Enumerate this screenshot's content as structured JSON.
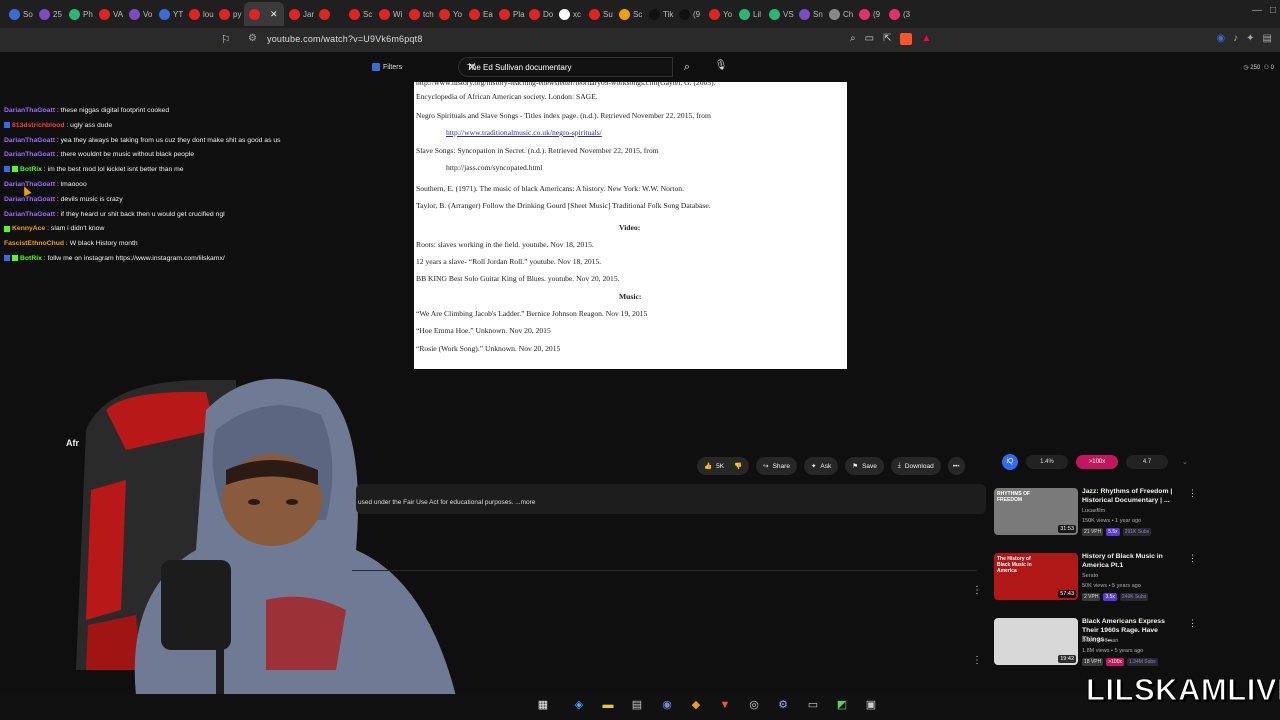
{
  "browser": {
    "tabs": [
      {
        "label": "So",
        "color": "#3b6bd6"
      },
      {
        "label": "25",
        "color": "#7a4cc2"
      },
      {
        "label": "Ph",
        "color": "#2bb673"
      },
      {
        "label": "VA",
        "color": "#e02424"
      },
      {
        "label": "Vo",
        "color": "#7a4cc2"
      },
      {
        "label": "YT",
        "color": "#3b6bd6"
      },
      {
        "label": "lou",
        "color": "#e02424"
      },
      {
        "label": "py",
        "color": "#e02424"
      },
      {
        "label": "",
        "color": "#e02424",
        "active": true
      },
      {
        "label": "Jar",
        "color": "#e02424"
      },
      {
        "label": "",
        "color": "#e02424"
      },
      {
        "label": "Sc",
        "color": "#e02424"
      },
      {
        "label": "Wi",
        "color": "#e02424"
      },
      {
        "label": "tch",
        "color": "#e02424"
      },
      {
        "label": "Yo",
        "color": "#e02424"
      },
      {
        "label": "Ea",
        "color": "#e02424"
      },
      {
        "label": "Pla",
        "color": "#e02424"
      },
      {
        "label": "Do",
        "color": "#e02424"
      },
      {
        "label": "xc",
        "color": "#ffffff"
      },
      {
        "label": "Su",
        "color": "#e02424"
      },
      {
        "label": "Sc",
        "color": "#f0a000"
      },
      {
        "label": "Tik",
        "color": "#111111"
      },
      {
        "label": "(9",
        "color": "#111111"
      },
      {
        "label": "Yo",
        "color": "#e02424"
      },
      {
        "label": "Lil",
        "color": "#2bb673"
      },
      {
        "label": "VS",
        "color": "#2bb673"
      },
      {
        "label": "Sn",
        "color": "#7a4cc2"
      },
      {
        "label": "Ch",
        "color": "#888888"
      },
      {
        "label": "(9",
        "color": "#e1306c"
      },
      {
        "label": "(3",
        "color": "#e1306c"
      }
    ],
    "url": "youtube.com/watch?v=U9Vk6m6pqt8"
  },
  "yt": {
    "filters_label": "Filters",
    "search_value": "The Ed Sullivan  documentary",
    "counter": "250",
    "counter2": "0"
  },
  "doc": {
    "lines": [
      {
        "text": "http://www.history.org/history-teaching-enewsletter/february09-worksongs.cfm(Gaytel, G. (2005).",
        "cls": ""
      },
      {
        "text": "Encyclopedia of African American society. London: SAGE.",
        "cls": ""
      },
      {
        "text": "Negro Spirituals and Slave Songs - Titles index page. (n.d.). Retrieved November 22, 2015, from",
        "cls": ""
      },
      {
        "text": "http://www.traditionalmusic.co.uk/negro-spirituals/",
        "cls": "lnk"
      },
      {
        "text": "Slave Songs: Syncopation in Secret. (n.d.). Retrieved November 22, 2015, from",
        "cls": ""
      },
      {
        "text": "http://jass.com/syncopated.html",
        "cls": ""
      },
      {
        "text": "Southern, E. (1971). The music of black Americans: A history. New York: W.W. Norton.",
        "cls": ""
      },
      {
        "text": "Taylor, B. (Arranger) Follow the Drinking Gourd [Sheet Music] Traditional Folk Song Database.",
        "cls": ""
      },
      {
        "text": "Video:",
        "cls": "hd"
      },
      {
        "text": "Roots: slaves working in the field. youtube. Nov 18, 2015.",
        "cls": ""
      },
      {
        "text": "12 years a slave- “Roll Jordan Roll.” youtube. Nov 18, 2015.",
        "cls": ""
      },
      {
        "text": "BB KING Best Solo Guitar King of Blues. youtube. Nov 20, 2015.",
        "cls": ""
      },
      {
        "text": "Music:",
        "cls": "hd"
      },
      {
        "text": "“We Are Climbing Jacob's Ladder.” Bernice Johnson Reagon. Nov 19, 2015",
        "cls": ""
      },
      {
        "text": "“Hoe Emma Hoe.” Unknown. Nov 20, 2015",
        "cls": ""
      },
      {
        "text": "“Rosie (Work Song).” Unknown. Nov 20, 2015",
        "cls": ""
      }
    ]
  },
  "chat": [
    {
      "user": "DarianThaGoatt",
      "color": "#9b6bff",
      "msg": "these niggas digital footprint cooked",
      "badges": []
    },
    {
      "user": "813dstrichblood",
      "color": "#ff3b3b",
      "msg": "ugly ass dude",
      "badges": [
        "#2f6bf5"
      ]
    },
    {
      "user": "DarianThaGoatt",
      "color": "#9b6bff",
      "msg": "yea they always be taking from us cuz they dont make shit as good as us",
      "badges": []
    },
    {
      "user": "DarianThaGoatt",
      "color": "#9b6bff",
      "msg": "there wouldnt be music without black people",
      "badges": []
    },
    {
      "user": "BotRix",
      "color": "#53fc18",
      "msg": "im the best mod lol kicklet isnt better than me",
      "badges": [
        "#2f6bf5",
        "#53fc18"
      ]
    },
    {
      "user": "DarianThaGoatt",
      "color": "#9b6bff",
      "msg": "lmaoooo",
      "badges": []
    },
    {
      "user": "DarianThaGoatt",
      "color": "#9b6bff",
      "msg": "devils music is crazy",
      "badges": []
    },
    {
      "user": "DarianThaGoatt",
      "color": "#9b6bff",
      "msg": "if they heard ur shit back then u would get crucified ngl",
      "badges": []
    },
    {
      "user": "KennyAce",
      "color": "#f0a000",
      "msg": "slam i didn't know",
      "badges": [
        "#53fc18"
      ]
    },
    {
      "user": "FascistEthnoChud",
      "color": "#f0a000",
      "msg": "W black History month",
      "badges": []
    },
    {
      "user": "BotRix",
      "color": "#53fc18",
      "msg": "follw me on instagram https://www.instagram.com/lilskamx/",
      "badges": [
        "#2f6bf5",
        "#53fc18"
      ]
    }
  ],
  "video": {
    "title": "Afr",
    "like_count": "5K",
    "share_label": "Share",
    "ask_label": "Ask",
    "save_label": "Save",
    "download_label": "Download",
    "description": "used under the Fair Use Act for educational purposes.  ...more"
  },
  "extension": {
    "stat1": "1.4%",
    "stat2": ">100x",
    "stat3": "4.7"
  },
  "recommendations": [
    {
      "title": "Jazz: Rhythms of Freedom | Historical Documentary | ...",
      "channel": "Lucasfilm",
      "meta": "150K views • 1 year ago",
      "duration": "31:53",
      "thumb_text": "RHYTHMS OF FREEDOM",
      "badges": [
        "21 VPH",
        "5.5x",
        "291K Subs"
      ],
      "thumb_bg": "#7a7a7a"
    },
    {
      "title": "History of Black Music in America Pt.1",
      "channel": "Serato",
      "meta": "50K views • 5 years ago",
      "duration": "57:43",
      "thumb_text": "The History of Black Music in America",
      "badges": [
        "2 VPH",
        "3.5x",
        "249K Subs"
      ],
      "thumb_bg": "#b01818"
    },
    {
      "title": "Black Americans Express Their 1960s Rage. Have Things ...",
      "channel": "David Hoffman",
      "meta": "1.8M views • 5 years ago",
      "duration": "19:42",
      "thumb_text": "",
      "badges": [
        "18 VPH",
        ">100x",
        "1.34M Subs"
      ],
      "thumb_bg": "#d8d8d8"
    }
  ],
  "brand": "LILSKAMLIVE"
}
